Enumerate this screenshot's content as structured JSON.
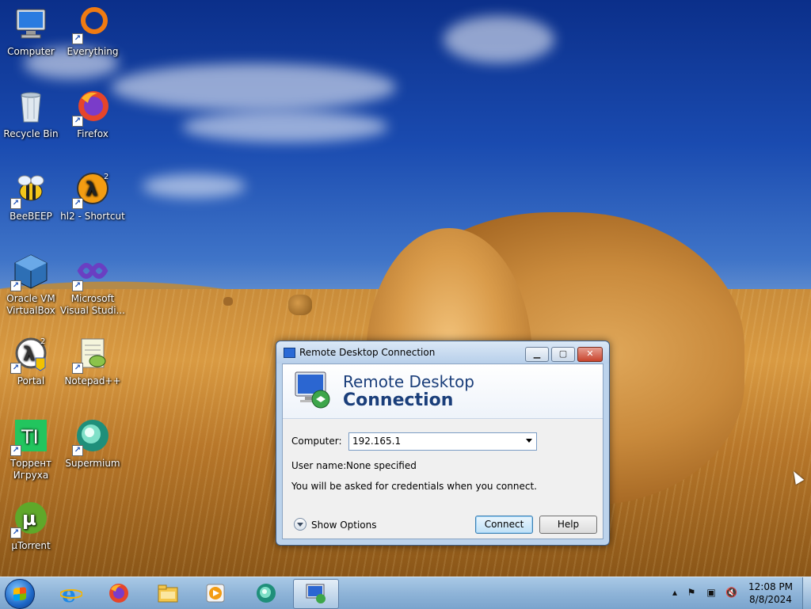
{
  "desktop": {
    "icons": [
      {
        "label": "Computer"
      },
      {
        "label": "Everything"
      },
      {
        "label": "Recycle Bin"
      },
      {
        "label": "Firefox"
      },
      {
        "label": "BeeBEEP"
      },
      {
        "label": "hl2 - Shortcut"
      },
      {
        "label": "Oracle VM VirtualBox"
      },
      {
        "label": "Microsoft Visual Studi..."
      },
      {
        "label": "Portal"
      },
      {
        "label": "Notepad++"
      },
      {
        "label": "Торрент Игруха"
      },
      {
        "label": "Supermium"
      },
      {
        "label": "µTorrent"
      }
    ]
  },
  "rdp": {
    "title": "Remote Desktop Connection",
    "banner_line1": "Remote Desktop",
    "banner_line2": "Connection",
    "computer_label": "Computer:",
    "computer_value": "192.165.1",
    "username_label": "User name:",
    "username_value": "None specified",
    "info": "You will be asked for credentials when you connect.",
    "show_options": "Show Options",
    "connect": "Connect",
    "help": "Help"
  },
  "taskbar": {
    "clock_time": "12:08 PM",
    "clock_date": "8/8/2024"
  },
  "colors": {
    "taskbar": "#8fb4d8",
    "titlebar": "#b7cfea",
    "banner_text": "#1a3e7a",
    "close_button": "#c7442d"
  }
}
